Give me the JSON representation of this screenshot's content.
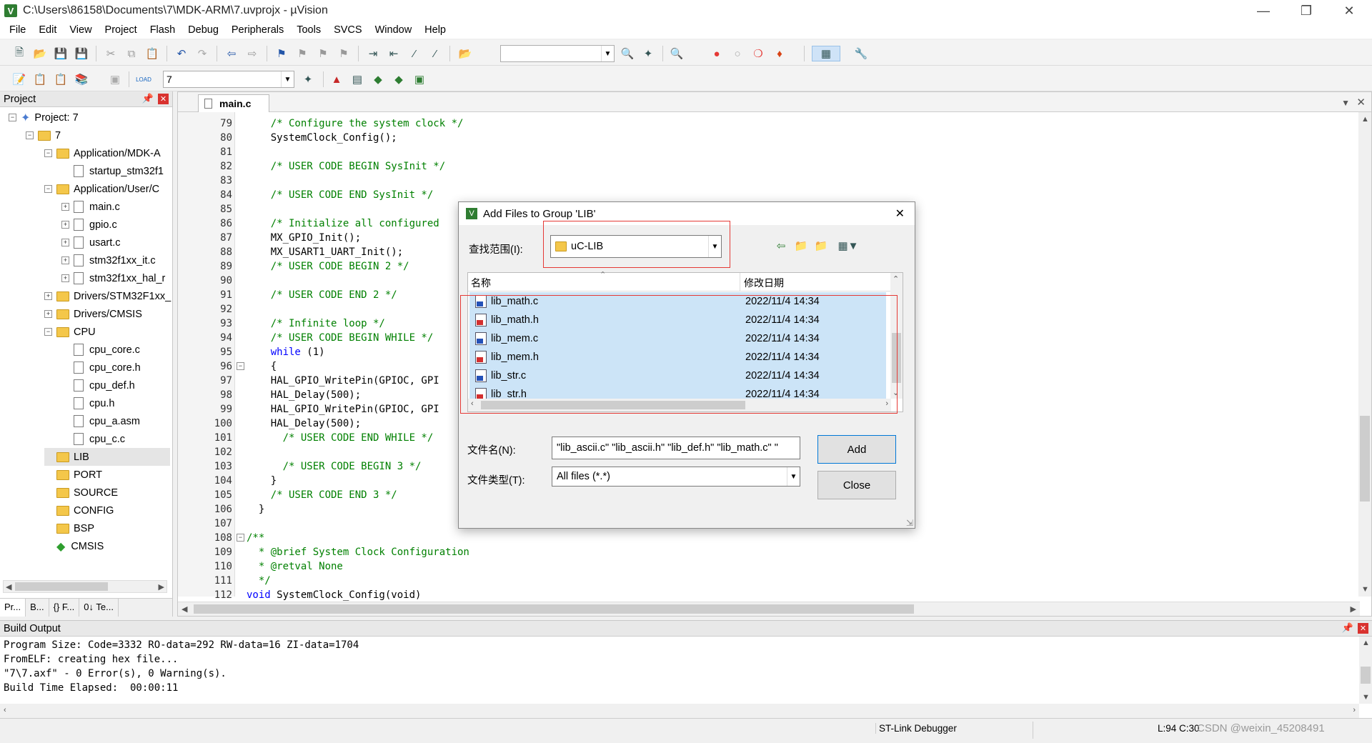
{
  "window": {
    "title": "C:\\Users\\86158\\Documents\\7\\MDK-ARM\\7.uvprojx - µVision",
    "app_icon": "V"
  },
  "menu": [
    "File",
    "Edit",
    "View",
    "Project",
    "Flash",
    "Debug",
    "Peripherals",
    "Tools",
    "SVCS",
    "Window",
    "Help"
  ],
  "toolbar2": {
    "target_value": "7",
    "load_label": "LOAD"
  },
  "project_pane": {
    "title": "Project",
    "tree": [
      {
        "label": "Project: 7",
        "level": 0,
        "expander": "−",
        "icon": "project"
      },
      {
        "label": "7",
        "level": 1,
        "expander": "−",
        "icon": "target"
      },
      {
        "label": "Application/MDK-A",
        "level": 2,
        "expander": "−",
        "icon": "folder"
      },
      {
        "label": "startup_stm32f1",
        "level": 3,
        "expander": "",
        "icon": "file"
      },
      {
        "label": "Application/User/C",
        "level": 2,
        "expander": "−",
        "icon": "folder"
      },
      {
        "label": "main.c",
        "level": 3,
        "expander": "+",
        "icon": "file"
      },
      {
        "label": "gpio.c",
        "level": 3,
        "expander": "+",
        "icon": "file"
      },
      {
        "label": "usart.c",
        "level": 3,
        "expander": "+",
        "icon": "file"
      },
      {
        "label": "stm32f1xx_it.c",
        "level": 3,
        "expander": "+",
        "icon": "file"
      },
      {
        "label": "stm32f1xx_hal_r",
        "level": 3,
        "expander": "+",
        "icon": "file"
      },
      {
        "label": "Drivers/STM32F1xx_",
        "level": 2,
        "expander": "+",
        "icon": "folder"
      },
      {
        "label": "Drivers/CMSIS",
        "level": 2,
        "expander": "+",
        "icon": "folder"
      },
      {
        "label": "CPU",
        "level": 2,
        "expander": "−",
        "icon": "folder"
      },
      {
        "label": "cpu_core.c",
        "level": 3,
        "expander": "",
        "icon": "file"
      },
      {
        "label": "cpu_core.h",
        "level": 3,
        "expander": "",
        "icon": "file"
      },
      {
        "label": "cpu_def.h",
        "level": 3,
        "expander": "",
        "icon": "file"
      },
      {
        "label": "cpu.h",
        "level": 3,
        "expander": "",
        "icon": "file"
      },
      {
        "label": "cpu_a.asm",
        "level": 3,
        "expander": "",
        "icon": "file"
      },
      {
        "label": "cpu_c.c",
        "level": 3,
        "expander": "",
        "icon": "file"
      },
      {
        "label": "LIB",
        "level": 2,
        "expander": "",
        "icon": "folder"
      },
      {
        "label": "PORT",
        "level": 2,
        "expander": "",
        "icon": "folder"
      },
      {
        "label": "SOURCE",
        "level": 2,
        "expander": "",
        "icon": "folder"
      },
      {
        "label": "CONFIG",
        "level": 2,
        "expander": "",
        "icon": "folder"
      },
      {
        "label": "BSP",
        "level": 2,
        "expander": "",
        "icon": "folder"
      },
      {
        "label": "CMSIS",
        "level": 2,
        "expander": "",
        "icon": "cmsis"
      }
    ],
    "tabs": [
      "Pr...",
      "B...",
      "{} F...",
      "0↓ Te..."
    ]
  },
  "editor": {
    "tab_label": "main.c",
    "lines": [
      {
        "n": "79",
        "t": "    /* Configure the system clock */",
        "c": "cmt"
      },
      {
        "n": "80",
        "t": "    SystemClock_Config();",
        "c": ""
      },
      {
        "n": "81",
        "t": "",
        "c": ""
      },
      {
        "n": "82",
        "t": "    /* USER CODE BEGIN SysInit */",
        "c": "cmt"
      },
      {
        "n": "83",
        "t": "",
        "c": ""
      },
      {
        "n": "84",
        "t": "    /* USER CODE END SysInit */",
        "c": "cmt"
      },
      {
        "n": "85",
        "t": "",
        "c": ""
      },
      {
        "n": "86",
        "t": "    /* Initialize all configured",
        "c": "cmt"
      },
      {
        "n": "87",
        "t": "    MX_GPIO_Init();",
        "c": ""
      },
      {
        "n": "88",
        "t": "    MX_USART1_UART_Init();",
        "c": ""
      },
      {
        "n": "89",
        "t": "    /* USER CODE BEGIN 2 */",
        "c": "cmt"
      },
      {
        "n": "90",
        "t": "",
        "c": ""
      },
      {
        "n": "91",
        "t": "    /* USER CODE END 2 */",
        "c": "cmt"
      },
      {
        "n": "92",
        "t": "",
        "c": ""
      },
      {
        "n": "93",
        "t": "    /* Infinite loop */",
        "c": "cmt"
      },
      {
        "n": "94",
        "t": "    /* USER CODE BEGIN WHILE */",
        "c": "cmt"
      },
      {
        "n": "95",
        "t": "    while (1)",
        "c": "kw"
      },
      {
        "n": "96",
        "t": "    {",
        "c": ""
      },
      {
        "n": "97",
        "t": "    HAL_GPIO_WritePin(GPIOC, GPI",
        "c": ""
      },
      {
        "n": "98",
        "t": "    HAL_Delay(500);",
        "c": ""
      },
      {
        "n": "99",
        "t": "    HAL_GPIO_WritePin(GPIOC, GPI",
        "c": ""
      },
      {
        "n": "100",
        "t": "    HAL_Delay(500);",
        "c": ""
      },
      {
        "n": "101",
        "t": "      /* USER CODE END WHILE */",
        "c": "cmt"
      },
      {
        "n": "102",
        "t": "",
        "c": ""
      },
      {
        "n": "103",
        "t": "      /* USER CODE BEGIN 3 */",
        "c": "cmt"
      },
      {
        "n": "104",
        "t": "    }",
        "c": ""
      },
      {
        "n": "105",
        "t": "    /* USER CODE END 3 */",
        "c": "cmt"
      },
      {
        "n": "106",
        "t": "  }",
        "c": ""
      },
      {
        "n": "107",
        "t": "",
        "c": ""
      },
      {
        "n": "108",
        "t": "/**",
        "c": "cmt"
      },
      {
        "n": "109",
        "t": "  * @brief System Clock Configuration",
        "c": "cmt"
      },
      {
        "n": "110",
        "t": "  * @retval None",
        "c": "cmt"
      },
      {
        "n": "111",
        "t": "  */",
        "c": "cmt"
      },
      {
        "n": "112",
        "t": "void SystemClock_Config(void)",
        "c": "kw"
      }
    ]
  },
  "dialog": {
    "title": "Add Files to Group 'LIB'",
    "look_in_label": "查找范围(I):",
    "look_in_value": "uC-LIB",
    "col_name": "名称",
    "col_date": "修改日期",
    "files": [
      {
        "name": "lib_math.c",
        "date": "2022/11/4 14:34",
        "type": "c"
      },
      {
        "name": "lib_math.h",
        "date": "2022/11/4 14:34",
        "type": "h"
      },
      {
        "name": "lib_mem.c",
        "date": "2022/11/4 14:34",
        "type": "c"
      },
      {
        "name": "lib_mem.h",
        "date": "2022/11/4 14:34",
        "type": "h"
      },
      {
        "name": "lib_str.c",
        "date": "2022/11/4 14:34",
        "type": "c"
      },
      {
        "name": "lib_str.h",
        "date": "2022/11/4 14:34",
        "type": "h"
      }
    ],
    "filename_label": "文件名(N):",
    "filename_value": "\"lib_ascii.c\" \"lib_ascii.h\" \"lib_def.h\" \"lib_math.c\" \"",
    "filetype_label": "文件类型(T):",
    "filetype_value": "All files (*.*)",
    "add_label": "Add",
    "close_label": "Close"
  },
  "build_output": {
    "title": "Build Output",
    "lines": [
      "Program Size: Code=3332 RO-data=292 RW-data=16 ZI-data=1704",
      "FromELF: creating hex file...",
      "\"7\\7.axf\" - 0 Error(s), 0 Warning(s).",
      "Build Time Elapsed:  00:00:11"
    ]
  },
  "status": {
    "debugger": "ST-Link Debugger",
    "position": "L:94 C:30",
    "watermark": "CSDN @weixin_45208491"
  }
}
